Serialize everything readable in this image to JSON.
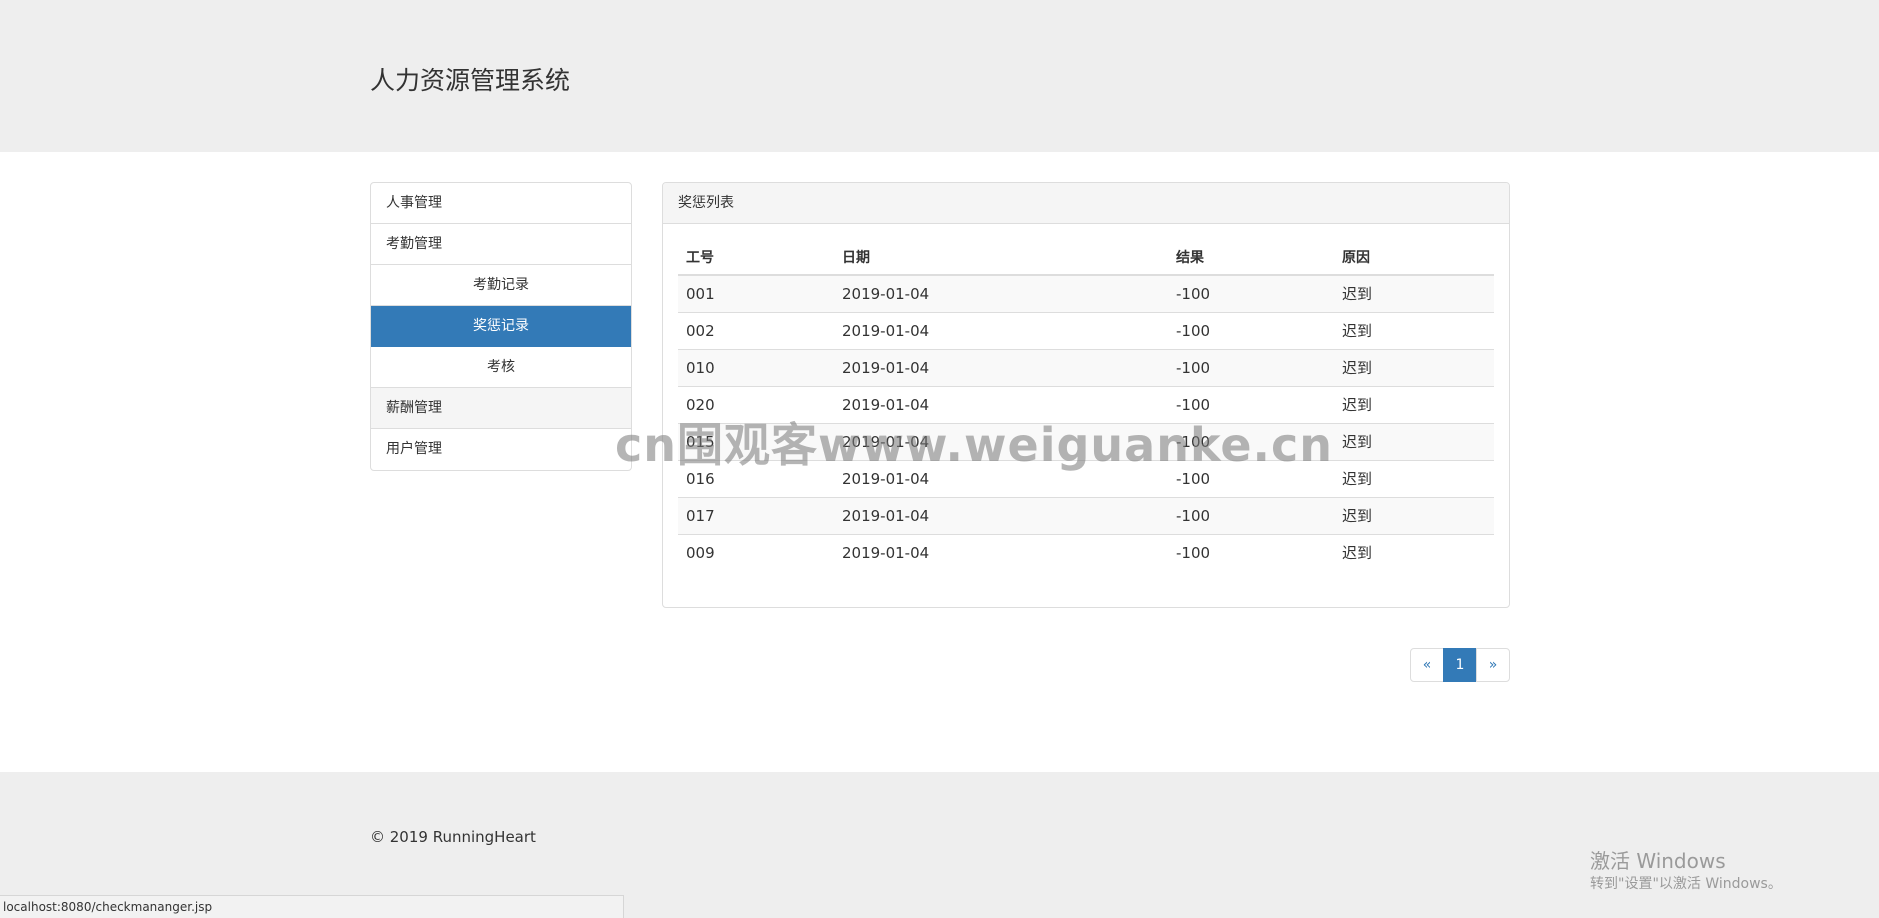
{
  "header": {
    "title": "人力资源管理系统"
  },
  "sidebar": {
    "items": [
      {
        "label": "人事管理"
      },
      {
        "label": "考勤管理"
      },
      {
        "label": "考勤记录"
      },
      {
        "label": "奖惩记录"
      },
      {
        "label": "考核"
      },
      {
        "label": "薪酬管理"
      },
      {
        "label": "用户管理"
      }
    ],
    "active_color": "#337ab7"
  },
  "panel": {
    "title": "奖惩列表",
    "columns": [
      "工号",
      "日期",
      "结果",
      "原因"
    ],
    "rows": [
      [
        "001",
        "2019-01-04",
        "-100",
        "迟到"
      ],
      [
        "002",
        "2019-01-04",
        "-100",
        "迟到"
      ],
      [
        "010",
        "2019-01-04",
        "-100",
        "迟到"
      ],
      [
        "020",
        "2019-01-04",
        "-100",
        "迟到"
      ],
      [
        "015",
        "2019-01-04",
        "-100",
        "迟到"
      ],
      [
        "016",
        "2019-01-04",
        "-100",
        "迟到"
      ],
      [
        "017",
        "2019-01-04",
        "-100",
        "迟到"
      ],
      [
        "009",
        "2019-01-04",
        "-100",
        "迟到"
      ]
    ]
  },
  "pagination": {
    "prev": "«",
    "current": "1",
    "next": "»"
  },
  "footer": {
    "copyright": "© 2019 RunningHeart"
  },
  "windows_activation": {
    "title": "激活 Windows",
    "subtitle": "转到\"设置\"以激活 Windows。"
  },
  "status_bar": {
    "url": "localhost:8080/checkmananger.jsp"
  },
  "watermark": {
    "text": "cn围观客www.weiguanke.cn"
  }
}
